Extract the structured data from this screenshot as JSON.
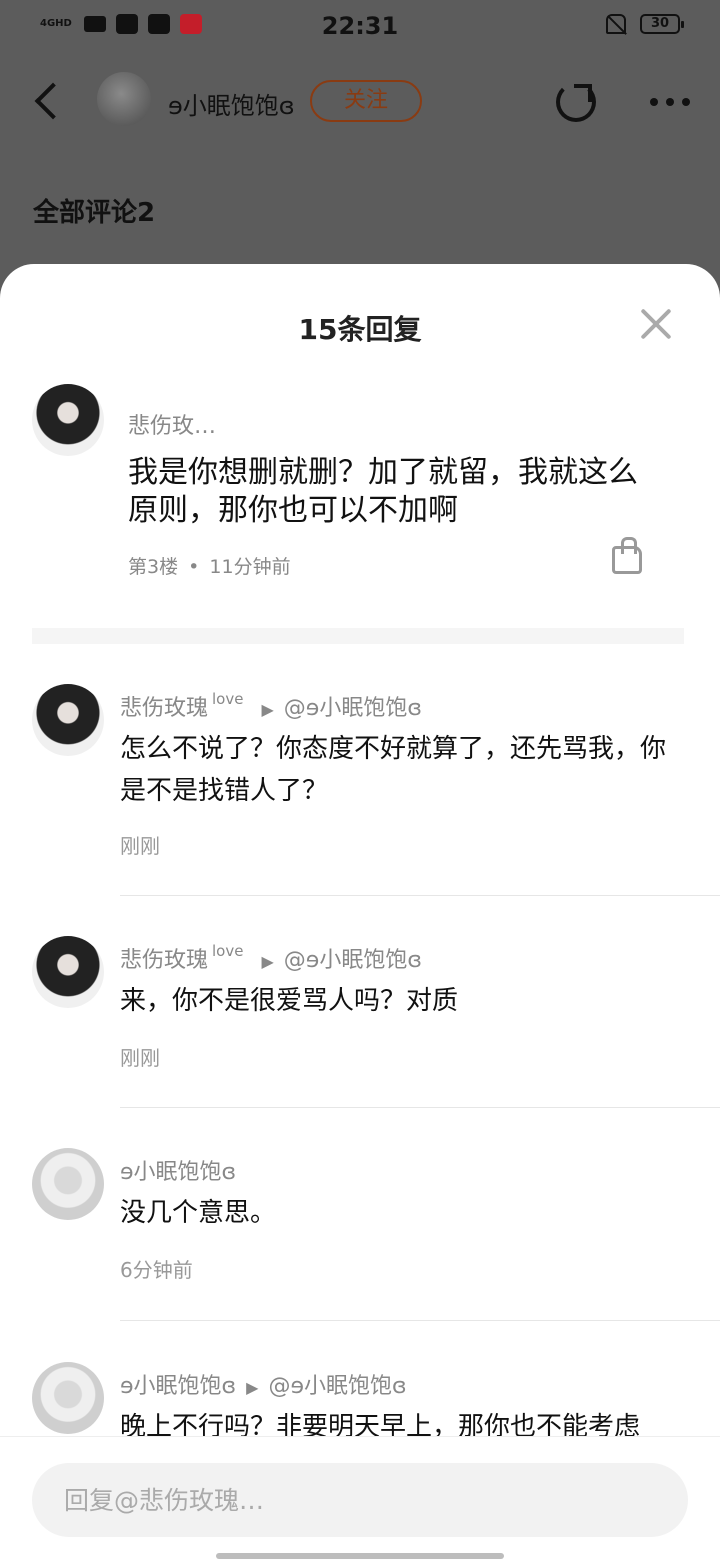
{
  "status": {
    "network": "4GHD",
    "time": "22:31",
    "battery": "30",
    "notif_icon_text": "小红书"
  },
  "header": {
    "username": "ɘ小眠饱饱ɞ",
    "follow_label": "关注",
    "section_title": "全部评论2"
  },
  "sheet": {
    "title": "15条回复",
    "main_comment": {
      "author": "悲伤玫…",
      "text": "我是你想删就删？加了就留，我就这么原则，那你也可以不加啊",
      "floor": "第3楼",
      "separator": "•",
      "time": "11分钟前"
    },
    "replies": [
      {
        "author": "悲伤玫瑰",
        "badge": "love",
        "arrow": "▶",
        "target": "@ɘ小眠饱饱ɞ",
        "text": "怎么不说了？你态度不好就算了，还先骂我，你是不是找错人了？",
        "time": "刚刚",
        "avatar": "dark"
      },
      {
        "author": "悲伤玫瑰",
        "badge": "love",
        "arrow": "▶",
        "target": "@ɘ小眠饱饱ɞ",
        "text": "来，你不是很爱骂人吗？对质",
        "time": "刚刚",
        "avatar": "dark"
      },
      {
        "author": "ɘ小眠饱饱ɞ",
        "badge": "",
        "arrow": "",
        "target": "",
        "text": "没几个意思。",
        "time": "6分钟前",
        "avatar": "light"
      },
      {
        "author": "ɘ小眠饱饱ɞ",
        "badge": "",
        "arrow": "▶",
        "target": "@ɘ小眠饱饱ɞ",
        "text": "晚上不行吗？非要明天早上，那你也不能考虑",
        "time": "",
        "avatar": "light"
      }
    ]
  },
  "input": {
    "placeholder": "回复@悲伤玫瑰…"
  },
  "colors": {
    "follow": "#8a3b12",
    "overlay": "#5c5c5c",
    "meta": "#888888"
  }
}
